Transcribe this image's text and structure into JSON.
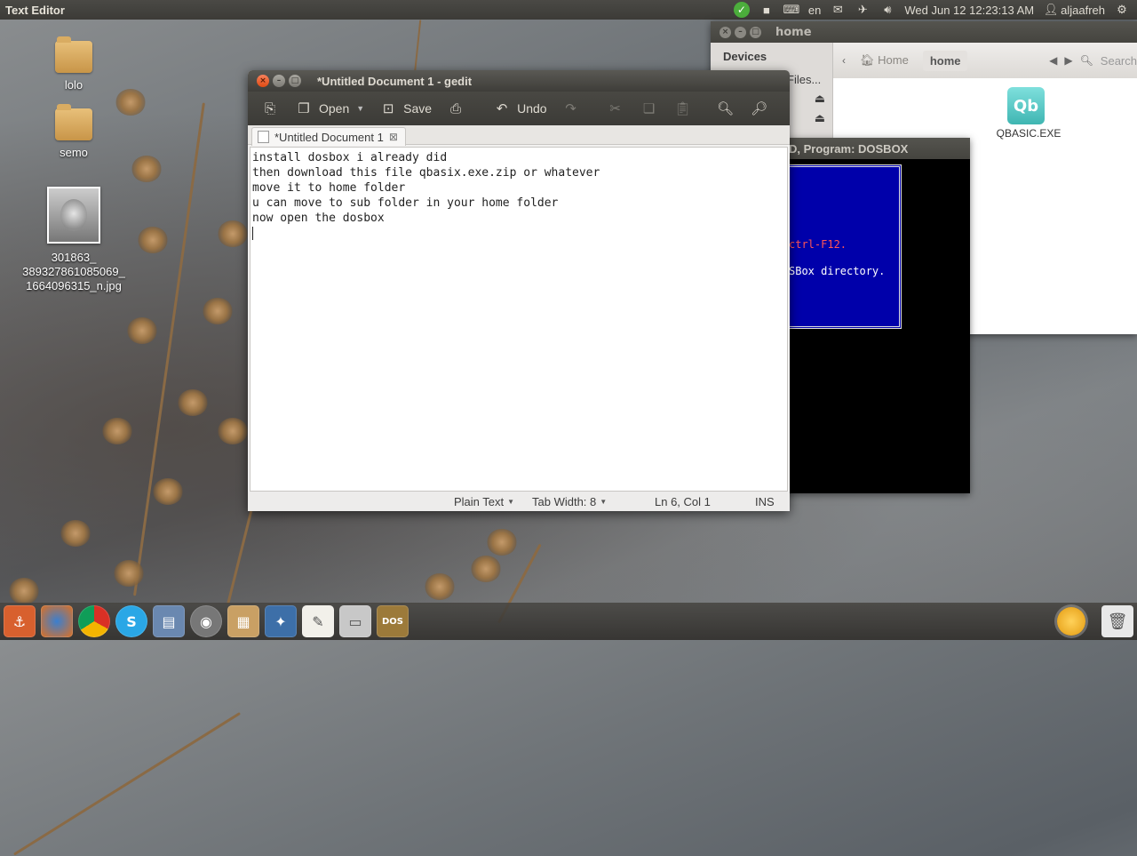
{
  "panel": {
    "app_title": "Text Editor",
    "keyboard_layout": "en",
    "clock": "Wed Jun 12 12:23:13 AM",
    "username": "aljaafreh"
  },
  "desktop": {
    "icons": [
      {
        "label": "lolo"
      },
      {
        "label": "semo"
      },
      {
        "label": "301863_\n389327861085069_\n1664096315_n.jpg"
      }
    ]
  },
  "files_window": {
    "title": "home",
    "sidebar_heading": "Devices",
    "sidebar_items": [
      "Files...",
      "",
      ""
    ],
    "breadcrumbs": [
      "Home",
      "home"
    ],
    "search_label": "Search",
    "file_icon_text": "Qb",
    "file_label": "QBASIC.EXE"
  },
  "dosbox": {
    "title": "D, Program:  DOSBOX",
    "line1": "ctrl-F12.",
    "line2": "SBox directory."
  },
  "gedit": {
    "title": "*Untitled Document 1 - gedit",
    "toolbar": {
      "open": "Open",
      "save": "Save",
      "undo": "Undo"
    },
    "tab_label": "*Untitled Document 1",
    "lines": [
      "install dosbox i already did",
      "then download this file qbasix.exe.zip or whatever",
      "move it to home folder",
      "u can move to sub folder in your home folder",
      "now open the dosbox"
    ],
    "status": {
      "language": "Plain Text",
      "tab_width": "Tab Width:  8",
      "position": "Ln 6, Col 1",
      "mode": "INS"
    }
  },
  "launcher": {
    "items": [
      "dash-icon",
      "firefox-icon",
      "chrome-icon",
      "skype-icon",
      "files-icon",
      "speaker-icon",
      "package-icon",
      "bluefish-icon",
      "text-editor-icon",
      "scanner-icon",
      "dosbox-icon"
    ]
  },
  "colors": {
    "panel": "#3c3b37",
    "close_button": "#df4b13",
    "dos_blue": "#0000aa"
  }
}
